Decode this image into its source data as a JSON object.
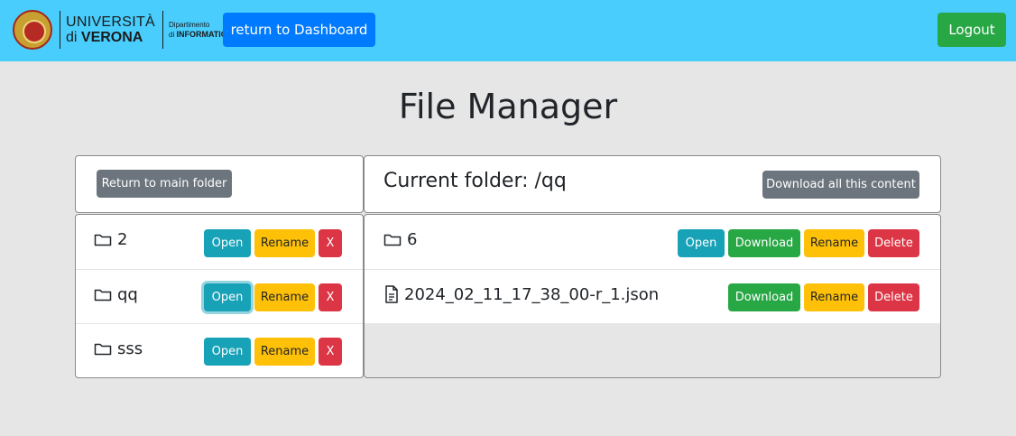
{
  "header": {
    "logo": {
      "line1": "UNIVERSITÀ",
      "line2_prefix": "di",
      "line2_bold": "VERONA",
      "dept_line1": "Dipartimento",
      "dept_line2_prefix": "di",
      "dept_line2_bold": "INFORMATICA"
    },
    "dashboard_button": "return to Dashboard",
    "logout_button": "Logout"
  },
  "page_title": "File Manager",
  "left_panel": {
    "return_button": "Return to main folder",
    "folders": [
      {
        "name": "2",
        "open": "Open",
        "rename": "Rename",
        "delete": "X"
      },
      {
        "name": "qq",
        "open": "Open",
        "rename": "Rename",
        "delete": "X"
      },
      {
        "name": "sss",
        "open": "Open",
        "rename": "Rename",
        "delete": "X"
      }
    ]
  },
  "right_panel": {
    "current_folder": "Current folder: /qq",
    "download_all_button": "Download all this content",
    "items": [
      {
        "type": "folder",
        "name": "6",
        "open": "Open",
        "download": "Download",
        "rename": "Rename",
        "delete": "Delete"
      },
      {
        "type": "file",
        "name": "2024_02_11_17_38_00-r_1.json",
        "download": "Download",
        "rename": "Rename",
        "delete": "Delete"
      }
    ]
  },
  "colors": {
    "navbar": "#48cdfd",
    "primary": "#007bff",
    "success": "#28a745",
    "info": "#17a2b8",
    "warning": "#ffc107",
    "danger": "#dc3545",
    "secondary": "#6c757d"
  },
  "icons": {
    "folder": "folder-icon",
    "file": "file-icon"
  }
}
